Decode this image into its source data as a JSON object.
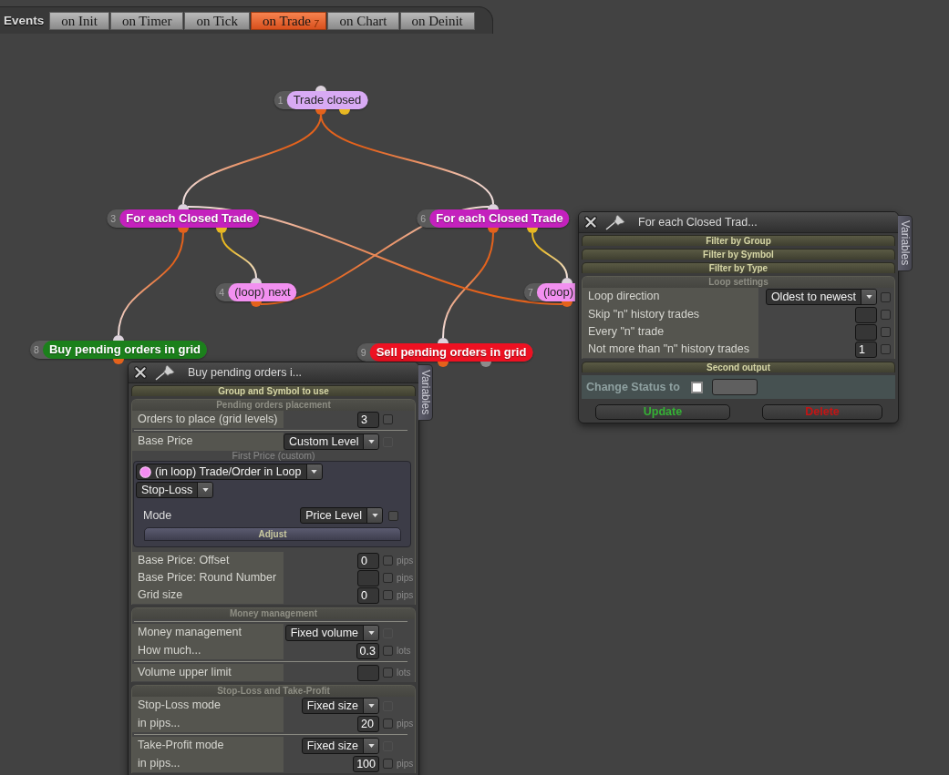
{
  "events_bar": {
    "label": "Events",
    "tabs": [
      {
        "label": "on Init",
        "selected": false
      },
      {
        "label": "on Timer",
        "selected": false
      },
      {
        "label": "on Tick",
        "selected": false
      },
      {
        "label": "on Trade",
        "selected": true,
        "badge": "7"
      },
      {
        "label": "on Chart",
        "selected": false
      },
      {
        "label": "on Deinit",
        "selected": false
      }
    ]
  },
  "nodes": [
    {
      "number": "1",
      "title": "Trade closed",
      "color": "#d8aaf4"
    },
    {
      "number": "3",
      "title": "For each Closed Trade",
      "color": "#c421bd"
    },
    {
      "number": "6",
      "title": "For each Closed Trade",
      "color": "#c421bd"
    },
    {
      "number": "4",
      "title": "(loop) next",
      "color": "#f290f0"
    },
    {
      "number": "7",
      "title": "(loop)",
      "color": "#f290f0"
    },
    {
      "number": "8",
      "title": "Buy pending orders in grid",
      "color": "#1b801b"
    },
    {
      "number": "9",
      "title": "Sell pending orders in grid",
      "color": "#ee1122"
    }
  ],
  "loop_panel": {
    "title": "For each Closed Trad...",
    "side_tab": "Variables",
    "sections": [
      {
        "title": "Filter by Group",
        "expanded": false
      },
      {
        "title": "Filter by Symbol",
        "expanded": false
      },
      {
        "title": "Filter by Type",
        "expanded": false
      },
      {
        "title": "Loop settings",
        "expanded": true,
        "rows": [
          {
            "kind": "select",
            "label": "Loop direction",
            "value": "Oldest to newest",
            "ruled": false,
            "check": {
              "checked": false,
              "disabled": false
            }
          },
          {
            "kind": "input",
            "label": "Skip \"n\" history trades",
            "ruled": false,
            "check": {
              "checked": false,
              "disabled": false
            }
          },
          {
            "kind": "input",
            "label": "Every \"n\" trade",
            "ruled": false,
            "check": {
              "checked": false,
              "disabled": false
            }
          },
          {
            "kind": "input",
            "label": "Not more than \"n\" history trades",
            "value": "1",
            "ruled": false,
            "check": {
              "checked": false,
              "disabled": false
            }
          }
        ]
      },
      {
        "title": "Second output",
        "expanded": false
      }
    ],
    "status_row": {
      "label": "Change Status to",
      "checked": false
    },
    "buttons": [
      {
        "label": "Update",
        "kind": "confirm"
      },
      {
        "label": "Delete",
        "kind": "danger"
      }
    ]
  },
  "grid_panel": {
    "title": "Buy pending orders i...",
    "side_tab": "Variables",
    "sections": [
      {
        "title": "Group and Symbol to use",
        "expanded": false
      },
      {
        "title": "Pending orders placement",
        "expanded": true,
        "rows": [
          {
            "kind": "input",
            "label": "Orders to place (grid levels)",
            "value": "3",
            "ruled": false,
            "check": {
              "checked": false,
              "disabled": false
            }
          },
          {
            "kind": "select",
            "label": "Base Price",
            "value": "Custom Level",
            "ruled": true,
            "check": {
              "checked": false,
              "disabled": true
            }
          },
          {
            "kind": "group",
            "caption": "First Price (custom)",
            "ruled": false,
            "rows": [
              {
                "kind": "source",
                "value": "(in loop) Trade/Order in Loop"
              },
              {
                "kind": "select",
                "value": "Stop-Loss"
              },
              {
                "kind": "select",
                "label": "Mode",
                "value": "Price Level",
                "check": {
                  "checked": false,
                  "disabled": false
                }
              },
              {
                "kind": "button",
                "label": "Adjust"
              }
            ]
          },
          {
            "kind": "input",
            "label": "Base Price: Offset",
            "value": "0",
            "unit": "pips",
            "ruled": false,
            "check": {
              "checked": false,
              "disabled": false
            }
          },
          {
            "kind": "input",
            "label": "Base Price: Round Number",
            "unit": "pips",
            "ruled": false,
            "check": {
              "checked": false,
              "disabled": false
            }
          },
          {
            "kind": "input",
            "label": "Grid size",
            "value": "0",
            "unit": "pips",
            "ruled": false,
            "check": {
              "checked": false,
              "disabled": false
            }
          }
        ]
      },
      {
        "title": "Money management",
        "expanded": true,
        "rows": [
          {
            "kind": "select",
            "label": "Money management",
            "value": "Fixed volume",
            "ruled": true,
            "check": {
              "checked": false,
              "disabled": true
            }
          },
          {
            "kind": "input",
            "label": "How much...",
            "value": "0.3",
            "unit": "lots",
            "ruled": false,
            "check": {
              "checked": false,
              "disabled": false
            }
          },
          {
            "kind": "input",
            "label": "Volume upper limit",
            "unit": "lots",
            "ruled": true,
            "check": {
              "checked": false,
              "disabled": false
            }
          }
        ]
      },
      {
        "title": "Stop-Loss and Take-Profit",
        "expanded": true,
        "rows": [
          {
            "kind": "select",
            "label": "Stop-Loss mode",
            "value": "Fixed size",
            "ruled": false,
            "check": {
              "checked": false,
              "disabled": true
            }
          },
          {
            "kind": "input",
            "label": "in pips...",
            "value": "20",
            "unit": "pips",
            "ruled": false,
            "check": {
              "checked": false,
              "disabled": false
            }
          },
          {
            "kind": "select",
            "label": "Take-Profit mode",
            "value": "Fixed size",
            "ruled": true,
            "check": {
              "checked": false,
              "disabled": true
            }
          },
          {
            "kind": "input",
            "label": "in pips...",
            "value": "100",
            "unit": "pips",
            "ruled": false,
            "check": {
              "checked": false,
              "disabled": false
            }
          }
        ]
      }
    ]
  }
}
